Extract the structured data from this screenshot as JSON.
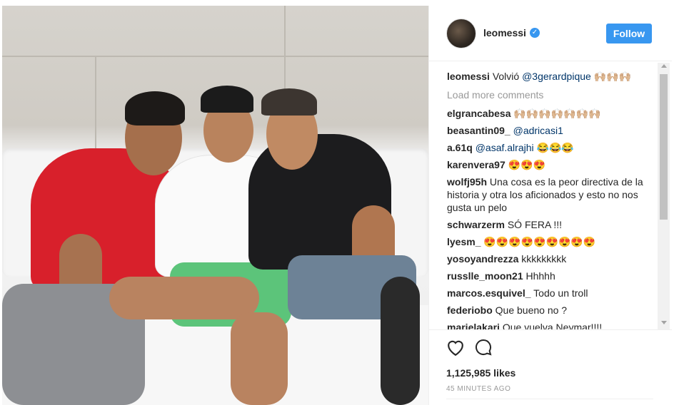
{
  "post": {
    "image_alt": "Photo of three friends sitting on a white sofa"
  },
  "header": {
    "username": "leomessi",
    "verified_icon": "verified-badge-icon",
    "follow_label": "Follow"
  },
  "comments": [
    {
      "user": "leomessi",
      "text_before": "Volvió ",
      "mention": "@3gerardpique",
      "text_after": " 🙌🏼🙌🏼🙌🏼"
    },
    {
      "load_more": "Load more comments"
    },
    {
      "user": "elgrancabesa",
      "text": "🙌🏼🙌🏼🙌🏼🙌🏼🙌🏼🙌🏼🙌🏼"
    },
    {
      "user": "beasantin09_",
      "mention": "@adricasi1"
    },
    {
      "user": "a.61q",
      "mention": "@asaf.alrajhi",
      "text_after": " 😂😂😂"
    },
    {
      "user": "karenvera97",
      "text": "😍😍😍"
    },
    {
      "user": "wolfj95h",
      "text": "Una cosa es la peor directiva de la historia y otra los aficionados y esto no nos gusta un pelo"
    },
    {
      "user": "schwarzerm",
      "text": "SÓ FERA !!!"
    },
    {
      "user": "lyesm_",
      "text": "😍😍😍😍😍😍😍😍😍"
    },
    {
      "user": "yosoyandrezza",
      "text": "kkkkkkkkk"
    },
    {
      "user": "russlle_moon21",
      "text": "Hhhhh"
    },
    {
      "user": "marcos.esquivel_",
      "text": "Todo un troll"
    },
    {
      "user": "federiobo",
      "text": "Que bueno no ?"
    },
    {
      "user": "marielakari",
      "text": "Que vuelva Neymar!!!!"
    }
  ],
  "actions": {
    "like_icon": "heart-icon",
    "comment_icon": "comment-icon",
    "likes": "1,125,985 likes",
    "time": "45 MINUTES AGO"
  },
  "colors": {
    "accent": "#3897f0",
    "text": "#262626",
    "muted": "#999999",
    "mention": "#003569"
  }
}
